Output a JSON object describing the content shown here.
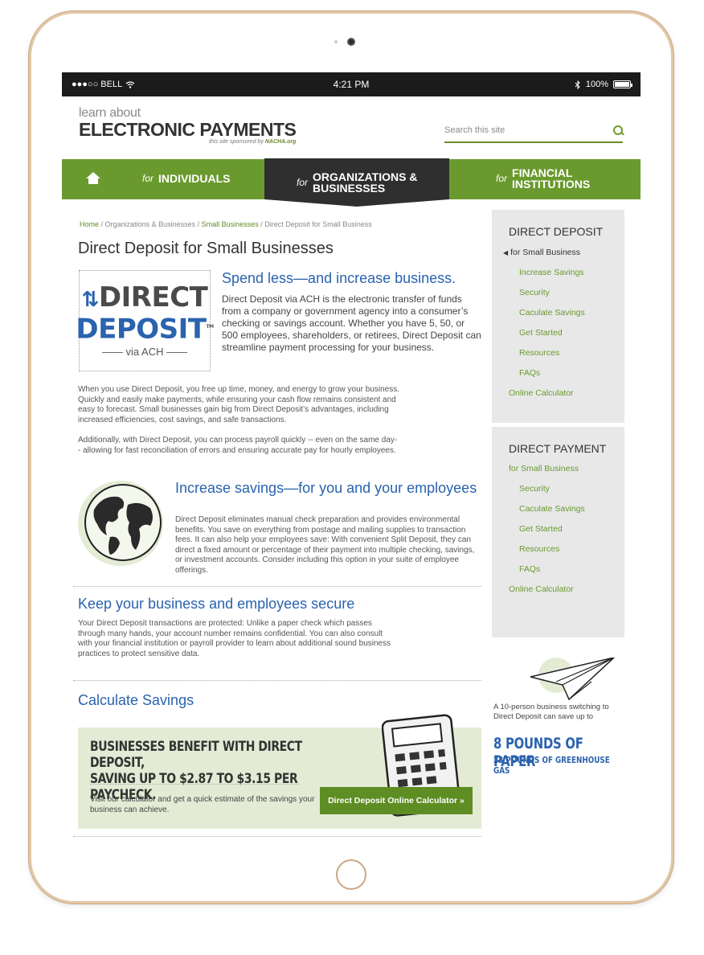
{
  "status_bar": {
    "carrier": "●●●○○ BELL",
    "time": "4:21 PM",
    "battery": "100%"
  },
  "header": {
    "logo_small": "learn about",
    "logo_big": "ELECTRONIC PAYMENTS",
    "logo_sponsor_prefix": "this site sponsored by",
    "logo_sponsor_name": "NACHA.org",
    "search_placeholder": "Search this site"
  },
  "nav": {
    "items": [
      {
        "for": "for",
        "label": "INDIVIDUALS"
      },
      {
        "for": "for",
        "label": "ORGANIZATIONS & BUSINESSES"
      },
      {
        "for": "for",
        "label": "FINANCIAL INSTITUTIONS"
      }
    ]
  },
  "breadcrumb": {
    "home": "Home",
    "sep": "/",
    "orgs": "Organizations & Businesses",
    "small": "Small Businesses",
    "current": "Direct Deposit for Small Business"
  },
  "main": {
    "title": "Direct Deposit for Small Businesses",
    "logo_line1": "DIRECT",
    "logo_line2": "DEPOSIT",
    "logo_line3": "via ACH",
    "logo_tm": "TM",
    "lead_heading": "Spend less—and increase business.",
    "lead_text": "Direct Deposit via ACH is the electronic transfer of funds from a company or government agency into a consumer’s checking or savings account. Whether you have 5, 50, or 500 employees, shareholders, or retirees, Direct Deposit can streamline payment processing for your business.",
    "para1": "When you use Direct Deposit, you free up time, money, and energy to grow your business. Quickly and easily make payments, while ensuring your cash flow remains consistent and easy to forecast. Small businesses gain big from Direct Deposit’s advantages, including increased efficiencies, cost savings, and safe transactions.",
    "para2": "Additionally, with Direct Deposit, you can process payroll quickly -- even on the same day-- allowing for fast reconciliation of errors and ensuring accurate pay for hourly employees.",
    "savings_heading": "Increase savings—for you and your employees",
    "savings_text": "Direct Deposit eliminates manual check preparation and provides environmental benefits. You save on everything from postage and mailing supplies to transaction fees. It can also help your employees save: With convenient Split Deposit, they can direct a fixed amount or percentage of their payment into multiple checking, savings, or investment accounts. Consider including this option in your suite of employee offerings.",
    "secure_heading": "Keep your business and employees secure",
    "secure_text": "Your Direct Deposit transactions are protected: Unlike a paper check which passes through many hands, your account number remains confidential. You can also consult with your financial institution or payroll provider to learn about additional sound business practices to protect sensitive data.",
    "calc_heading": "Calculate Savings",
    "calc_big_line1": "BUSINESSES BENEFIT WITH DIRECT DEPOSIT,",
    "calc_big_line2": "SAVING UP TO $2.87 TO $3.15 PER PAYCHECK.",
    "calc_note": "Visit our calculator and get a quick estimate of the savings your business can achieve.",
    "calc_button": "Direct Deposit Online Calculator »"
  },
  "sidebar": {
    "dd_title": "DIRECT DEPOSIT",
    "dd_active": "for Small Business",
    "dd_items": [
      "Increase Savings",
      "Security",
      "Caculate Savings",
      "Get Started",
      "Resources",
      "FAQs"
    ],
    "dd_calc": "Online Calculator",
    "dp_title": "DIRECT PAYMENT",
    "dp_top": "for Small Business",
    "dp_items": [
      "Security",
      "Caculate Savings",
      "Get Started",
      "Resources",
      "FAQs"
    ],
    "dp_calc": "Online Calculator"
  },
  "promo": {
    "text": "A 10-person business switching to Direct Deposit can save up to",
    "big": "8 POUNDS OF PAPER",
    "small": "23 POUNDS OF GREENHOUSE GAS"
  },
  "colors": {
    "green": "#6a9a2e",
    "dark_nav": "#2f2f2f",
    "blue": "#2a63ae",
    "sidebar_bg": "#e8e8e8"
  }
}
